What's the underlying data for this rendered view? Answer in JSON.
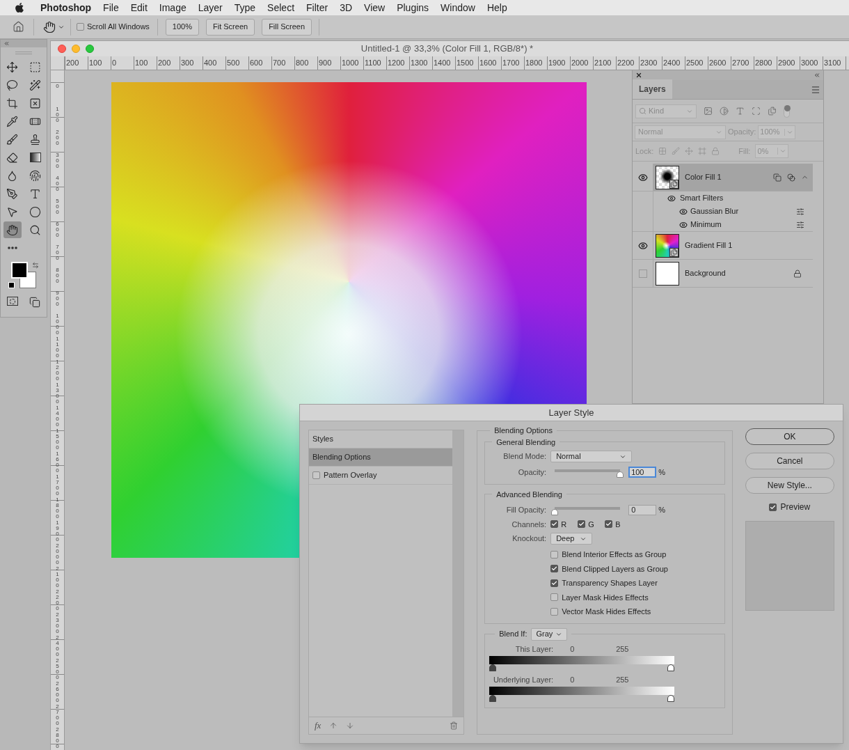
{
  "menu_bar": {
    "app": "Photoshop",
    "items": [
      "File",
      "Edit",
      "Image",
      "Layer",
      "Type",
      "Select",
      "Filter",
      "3D",
      "View",
      "Plugins",
      "Window",
      "Help"
    ]
  },
  "options_bar": {
    "scroll_all_windows": {
      "label": "Scroll All Windows",
      "checked": false
    },
    "buttons": [
      "100%",
      "Fit Screen",
      "Fill Screen"
    ]
  },
  "tools": [
    {
      "kind": "move",
      "selected": false
    },
    {
      "kind": "marquee",
      "selected": false
    },
    {
      "kind": "lasso",
      "selected": false
    },
    {
      "kind": "wand",
      "selected": false
    },
    {
      "kind": "crop",
      "selected": false
    },
    {
      "kind": "frame",
      "selected": false
    },
    {
      "kind": "eyedropper",
      "selected": false
    },
    {
      "kind": "healing",
      "selected": false
    },
    {
      "kind": "brush",
      "selected": false
    },
    {
      "kind": "stamp",
      "selected": false
    },
    {
      "kind": "eraser",
      "selected": false
    },
    {
      "kind": "gradient",
      "selected": false
    },
    {
      "kind": "blur",
      "selected": false
    },
    {
      "kind": "smudge",
      "selected": false
    },
    {
      "kind": "pen",
      "selected": false
    },
    {
      "kind": "type",
      "selected": false
    },
    {
      "kind": "path",
      "selected": false
    },
    {
      "kind": "ellipse",
      "selected": false
    },
    {
      "kind": "hand",
      "selected": true
    },
    {
      "kind": "zoom",
      "selected": false
    },
    {
      "kind": "more",
      "selected": false
    }
  ],
  "document": {
    "title": "Untitled-1 @ 33,3% (Color Fill 1, RGB/8*) *",
    "ruler_h": [
      "200",
      "100",
      "0",
      "100",
      "200",
      "300",
      "400",
      "500",
      "600",
      "700",
      "800",
      "900",
      "1000",
      "1100",
      "1200",
      "1300",
      "1400",
      "1500",
      "1600",
      "1700",
      "1800",
      "1900",
      "2000",
      "2100",
      "2200",
      "2300",
      "2400",
      "2500",
      "2600",
      "2700",
      "2800",
      "2900",
      "3000",
      "3100"
    ],
    "ruler_v": [
      "0",
      "100",
      "200",
      "300",
      "400",
      "500",
      "600",
      "700",
      "800",
      "900",
      "1000",
      "1100",
      "1200",
      "1300",
      "1400",
      "1500",
      "1600",
      "1700",
      "1800",
      "1900",
      "2000",
      "2100",
      "2200",
      "2300",
      "2400",
      "2500",
      "2600",
      "2700",
      "2800"
    ]
  },
  "layers_panel": {
    "tab": "Layers",
    "filter": "Kind",
    "blend_mode": "Normal",
    "opacity_label": "Opacity:",
    "opacity": "100%",
    "lock_label": "Lock:",
    "fill_label": "Fill:",
    "fill": "0%",
    "layers": [
      {
        "name": "Color Fill 1",
        "kind": "smart-fill",
        "visible": true,
        "selected": true,
        "locked": false,
        "smart_filters": {
          "label": "Smart Filters",
          "visible": true,
          "filters": [
            {
              "name": "Gaussian Blur",
              "visible": true
            },
            {
              "name": "Minimum",
              "visible": true
            }
          ]
        }
      },
      {
        "name": "Gradient Fill 1",
        "kind": "smart-gradient",
        "visible": true,
        "selected": false,
        "locked": false
      },
      {
        "name": "Background",
        "kind": "plain",
        "visible": false,
        "selected": false,
        "locked": true
      }
    ]
  },
  "layer_style": {
    "title": "Layer Style",
    "styles_list": [
      {
        "label": "Styles",
        "kind": "header",
        "selected": false
      },
      {
        "label": "Blending Options",
        "kind": "header",
        "selected": true
      },
      {
        "label": "Pattern Overlay",
        "kind": "checkbox",
        "checked": false,
        "selected": false
      }
    ],
    "footer": {
      "fx": "fx"
    },
    "blending": {
      "title": "Blending Options",
      "general": {
        "title": "General Blending",
        "blend_mode_label": "Blend Mode:",
        "blend_mode": "Normal",
        "opacity_label": "Opacity:",
        "opacity": {
          "level": 1,
          "value": "100",
          "unit": "%"
        }
      },
      "advanced": {
        "title": "Advanced Blending",
        "fill_opacity_label": "Fill Opacity:",
        "fill_opacity": {
          "level": 0,
          "value": "0",
          "unit": "%"
        },
        "channels_label": "Channels:",
        "channels": [
          {
            "label": "R",
            "checked": true
          },
          {
            "label": "G",
            "checked": true
          },
          {
            "label": "B",
            "checked": true
          }
        ],
        "knockout_label": "Knockout:",
        "knockout": "Deep",
        "options": [
          {
            "label": "Blend Interior Effects as Group",
            "checked": false
          },
          {
            "label": "Blend Clipped Layers as Group",
            "checked": true
          },
          {
            "label": "Transparency Shapes Layer",
            "checked": true
          },
          {
            "label": "Layer Mask Hides Effects",
            "checked": false
          },
          {
            "label": "Vector Mask Hides Effects",
            "checked": false
          }
        ]
      },
      "blend_if": {
        "label": "Blend If:",
        "value": "Gray",
        "sliders": [
          {
            "label": "This Layer:",
            "thumbs": [
              {
                "text": "0",
                "level": 0
              },
              {
                "text": "255",
                "level": 1
              }
            ]
          },
          {
            "label": "Underlying Layer:",
            "thumbs": [
              {
                "text": "0",
                "level": 0
              },
              {
                "text": "255",
                "level": 1
              }
            ]
          }
        ]
      }
    },
    "buttons": [
      {
        "label": "OK",
        "default": true
      },
      {
        "label": "Cancel",
        "default": false
      },
      {
        "label": "New Style...",
        "default": false
      }
    ],
    "preview": {
      "label": "Preview",
      "checked": true
    }
  }
}
